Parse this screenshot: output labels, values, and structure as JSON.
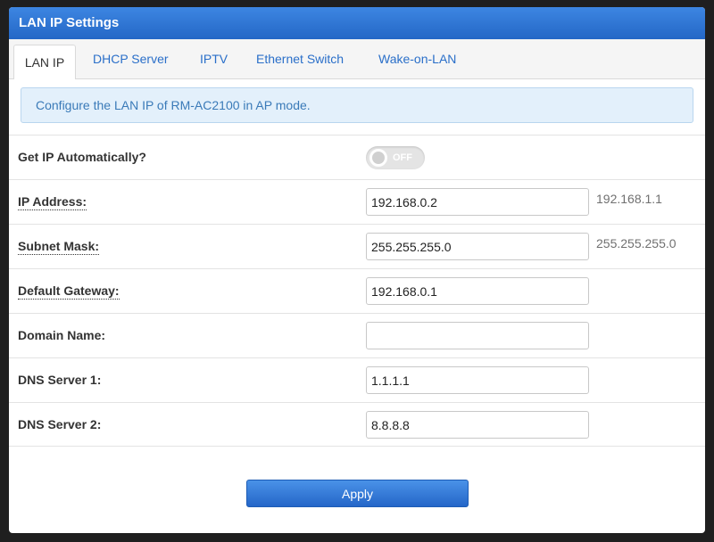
{
  "window": {
    "title": "LAN IP Settings"
  },
  "tabs": [
    {
      "label": "LAN IP",
      "active": true
    },
    {
      "label": "DHCP Server",
      "active": false
    },
    {
      "label": "IPTV",
      "active": false
    },
    {
      "label": "Ethernet Switch",
      "active": false
    },
    {
      "label": "Wake-on-LAN",
      "active": false
    }
  ],
  "info": {
    "message": "Configure the LAN IP of RM-AC2100 in AP mode."
  },
  "settings": {
    "auto_ip": {
      "label": "Get IP Automatically?",
      "toggle_text": "OFF",
      "enabled": false
    },
    "ip_address": {
      "label": "IP Address:",
      "value": "192.168.0.2",
      "hint": "192.168.1.1"
    },
    "subnet_mask": {
      "label": "Subnet Mask:",
      "value": "255.255.255.0",
      "hint": "255.255.255.0"
    },
    "default_gateway": {
      "label": "Default Gateway:",
      "value": "192.168.0.1"
    },
    "domain_name": {
      "label": "Domain Name:",
      "value": ""
    },
    "dns1": {
      "label": "DNS Server 1:",
      "value": "1.1.1.1"
    },
    "dns2": {
      "label": "DNS Server 2:",
      "value": "8.8.8.8"
    }
  },
  "actions": {
    "apply_label": "Apply"
  },
  "colors": {
    "title_bar": "#2a6fd1",
    "accent": "#2a6fc9",
    "info_bg": "#e3f0fb",
    "button": "#2466c8"
  }
}
